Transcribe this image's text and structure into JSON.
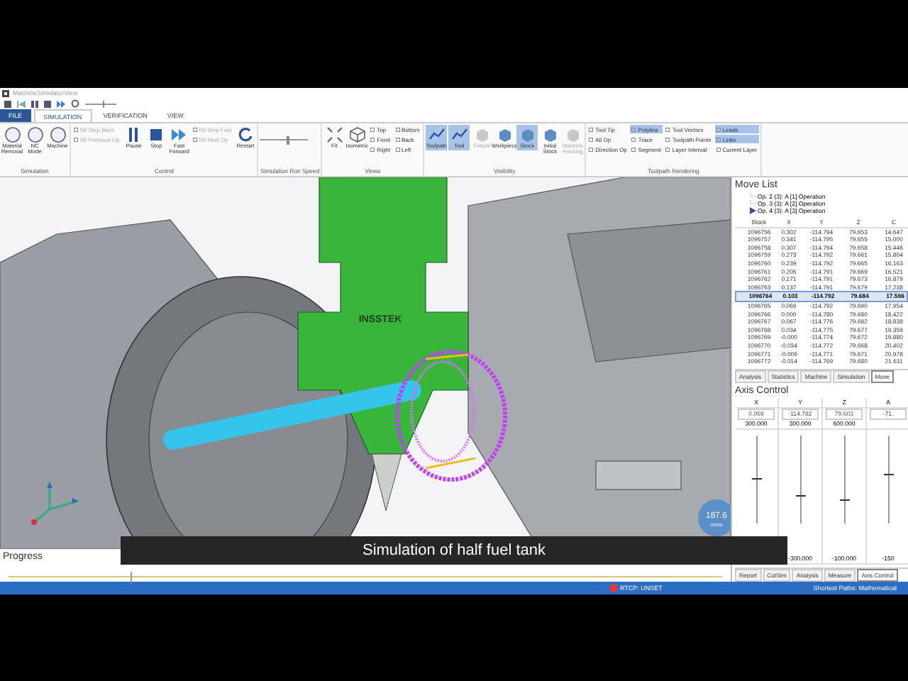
{
  "window": {
    "title": "MachineSimulatorView"
  },
  "ribbon_tabs": [
    {
      "label": "FILE",
      "kind": "file",
      "selected": false
    },
    {
      "label": "SIMULATION",
      "kind": "tab",
      "selected": true
    },
    {
      "label": "VERIFICATION",
      "kind": "tab",
      "selected": false
    },
    {
      "label": "VIEW",
      "kind": "tab",
      "selected": false
    }
  ],
  "ribbon_groups": [
    {
      "title": "Simulation",
      "items": [
        {
          "kind": "large",
          "label": "Material Removal",
          "selected": false,
          "disabled": false
        },
        {
          "kind": "large",
          "label": "NC Mode",
          "selected": false,
          "disabled": false
        },
        {
          "kind": "large",
          "label": "Machine",
          "selected": false,
          "disabled": false
        }
      ]
    },
    {
      "title": "Control",
      "items": [
        {
          "kind": "stack",
          "entries": [
            {
              "label": "Nil Step Back",
              "selected": false,
              "disabled": true
            },
            {
              "label": "Nil Previous Op",
              "selected": false,
              "disabled": true
            }
          ]
        },
        {
          "kind": "large",
          "label": "Pause",
          "selected": false,
          "disabled": false
        },
        {
          "kind": "large",
          "label": "Stop",
          "selected": false,
          "disabled": false
        },
        {
          "kind": "large",
          "label": "Fast Forward",
          "selected": false,
          "disabled": false
        },
        {
          "kind": "stack",
          "entries": [
            {
              "label": "Nil Step Fwd",
              "selected": false,
              "disabled": true
            },
            {
              "label": "Nil Next Op",
              "selected": false,
              "disabled": true
            }
          ]
        },
        {
          "kind": "large",
          "label": "Restart",
          "selected": false,
          "disabled": false
        }
      ]
    },
    {
      "title": "Simulation Run Speed",
      "items": [
        {
          "kind": "slider",
          "level": 0.55
        }
      ]
    },
    {
      "title": "Views",
      "items": [
        {
          "kind": "large",
          "label": "Fit",
          "selected": false,
          "disabled": false
        },
        {
          "kind": "large",
          "label": "Isometric",
          "selected": false,
          "disabled": false
        },
        {
          "kind": "stack",
          "entries": [
            {
              "label": "Top",
              "selected": false,
              "disabled": false
            },
            {
              "label": "Front",
              "selected": false,
              "disabled": false
            },
            {
              "label": "Right",
              "selected": false,
              "disabled": false
            }
          ]
        },
        {
          "kind": "stack",
          "entries": [
            {
              "label": "Bottom",
              "selected": false,
              "disabled": false
            },
            {
              "label": "Back",
              "selected": false,
              "disabled": false
            },
            {
              "label": "Left",
              "selected": false,
              "disabled": false
            }
          ]
        }
      ]
    },
    {
      "title": "Visibility",
      "items": [
        {
          "kind": "large",
          "label": "Toolpath",
          "selected": true,
          "disabled": false
        },
        {
          "kind": "large",
          "label": "Tool",
          "selected": true,
          "disabled": false
        },
        {
          "kind": "large",
          "label": "Fixture",
          "selected": false,
          "disabled": true
        },
        {
          "kind": "large",
          "label": "Workpiece",
          "selected": false,
          "disabled": false
        },
        {
          "kind": "large",
          "label": "Stock",
          "selected": true,
          "disabled": false
        },
        {
          "kind": "large",
          "label": "Initial Stock",
          "selected": false,
          "disabled": false
        },
        {
          "kind": "large",
          "label": "Machine Housing",
          "selected": false,
          "disabled": true
        }
      ]
    },
    {
      "title": "Toolpath Rendering",
      "items": [
        {
          "kind": "stack",
          "entries": [
            {
              "label": "Tool Tip",
              "selected": false,
              "disabled": false
            },
            {
              "label": "All Op",
              "selected": false,
              "disabled": false
            },
            {
              "label": "Direction Op",
              "selected": false,
              "disabled": false
            }
          ]
        },
        {
          "kind": "stack",
          "entries": [
            {
              "label": "Polyline",
              "selected": true,
              "disabled": false
            },
            {
              "label": "Trace",
              "selected": false,
              "disabled": false
            },
            {
              "label": "Segment",
              "selected": false,
              "disabled": false
            }
          ]
        },
        {
          "kind": "stack",
          "entries": [
            {
              "label": "Tool Vectors",
              "selected": false,
              "disabled": false
            },
            {
              "label": "Toolpath Points",
              "selected": false,
              "disabled": false
            },
            {
              "label": "Layer Interval",
              "selected": false,
              "disabled": false
            }
          ]
        },
        {
          "kind": "stack",
          "entries": [
            {
              "label": "Leads",
              "selected": true,
              "disabled": false
            },
            {
              "label": "Links",
              "selected": true,
              "disabled": false
            },
            {
              "label": "Current Layer",
              "selected": false,
              "disabled": false
            }
          ]
        }
      ]
    }
  ],
  "viewport": {
    "tool_label": "INSSTEK",
    "speed_badge": {
      "value": "187.6",
      "unit": "mm/s"
    }
  },
  "caption": "Simulation of half fuel tank",
  "move_list": {
    "title": "Move List",
    "operations": [
      {
        "label": "Op. 2 (3): A [1] Operation",
        "current": false
      },
      {
        "label": "Op. 3 (3): A [2] Operation",
        "current": false
      },
      {
        "label": "Op. 4 (3): A [3] Operation",
        "current": true
      }
    ],
    "columns": [
      "Block",
      "X",
      "Y",
      "Z",
      "C"
    ],
    "rows": [
      {
        "cells": [
          "1096756",
          "0.302",
          "-114.794",
          "79.653",
          "14.647"
        ],
        "selected": false
      },
      {
        "cells": [
          "1096757",
          "0.341",
          "-114.795",
          "79.655",
          "15.000"
        ],
        "selected": false
      },
      {
        "cells": [
          "1096758",
          "0.307",
          "-114.794",
          "79.658",
          "15.446"
        ],
        "selected": false
      },
      {
        "cells": [
          "1096759",
          "0.273",
          "-114.792",
          "79.661",
          "15.804"
        ],
        "selected": false
      },
      {
        "cells": [
          "1096760",
          "0.239",
          "-114.792",
          "79.665",
          "16.163"
        ],
        "selected": false
      },
      {
        "cells": [
          "1096761",
          "0.205",
          "-114.791",
          "79.669",
          "16.521"
        ],
        "selected": false
      },
      {
        "cells": [
          "1096762",
          "0.171",
          "-114.791",
          "79.673",
          "16.879"
        ],
        "selected": false
      },
      {
        "cells": [
          "1096763",
          "0.137",
          "-114.791",
          "79.679",
          "17.238"
        ],
        "selected": false
      },
      {
        "cells": [
          "1096764",
          "0.103",
          "-114.792",
          "79.684",
          "17.596"
        ],
        "selected": true
      },
      {
        "cells": [
          "1096765",
          "0.069",
          "-114.792",
          "79.690",
          "17.954"
        ],
        "selected": false
      },
      {
        "cells": [
          "1096766",
          "0.000",
          "-114.780",
          "79.680",
          "18.422"
        ],
        "selected": false
      },
      {
        "cells": [
          "1096767",
          "0.067",
          "-114.776",
          "79.682",
          "18.838"
        ],
        "selected": false
      },
      {
        "cells": [
          "1096768",
          "0.034",
          "-114.775",
          "79.677",
          "19.359"
        ],
        "selected": false
      },
      {
        "cells": [
          "1096769",
          "-0.000",
          "-114.774",
          "79.672",
          "19.880"
        ],
        "selected": false
      },
      {
        "cells": [
          "1096770",
          "-0.034",
          "-114.772",
          "79.668",
          "20.402"
        ],
        "selected": false
      },
      {
        "cells": [
          "1096771",
          "-0.009",
          "-114.771",
          "79.671",
          "20.978"
        ],
        "selected": false
      },
      {
        "cells": [
          "1096772",
          "-0.014",
          "-114.769",
          "79.680",
          "21.611"
        ],
        "selected": false
      }
    ],
    "tabs": [
      {
        "label": "Analysis",
        "selected": false
      },
      {
        "label": "Statistics",
        "selected": false
      },
      {
        "label": "Machine",
        "selected": false
      },
      {
        "label": "Simulation",
        "selected": false
      },
      {
        "label": "Move",
        "selected": true
      }
    ]
  },
  "axis_control": {
    "title": "Axis Control",
    "axes": [
      {
        "name": "X",
        "value": "0.069",
        "max": "300.000",
        "level": 0.5
      },
      {
        "name": "Y",
        "value": "-114.782",
        "max": "300.000",
        "min": "-300.000",
        "level": 0.31
      },
      {
        "name": "Z",
        "value": "79.603",
        "max": "600.000",
        "min": "-100.000",
        "level": 0.26
      },
      {
        "name": "A",
        "value": "-71.",
        "min": "-150",
        "level": 0.55
      }
    ],
    "tabs": [
      {
        "label": "Report",
        "selected": false
      },
      {
        "label": "CutSim",
        "selected": false
      },
      {
        "label": "Analysis",
        "selected": false
      },
      {
        "label": "Measure",
        "selected": false
      },
      {
        "label": "Axis Control",
        "selected": true
      }
    ]
  },
  "progress": {
    "title": "Progress",
    "level": 0.17
  },
  "status_bar": {
    "rtcp": "RTCP: UNSET",
    "paths": "Shortest Paths: Mathematical"
  }
}
